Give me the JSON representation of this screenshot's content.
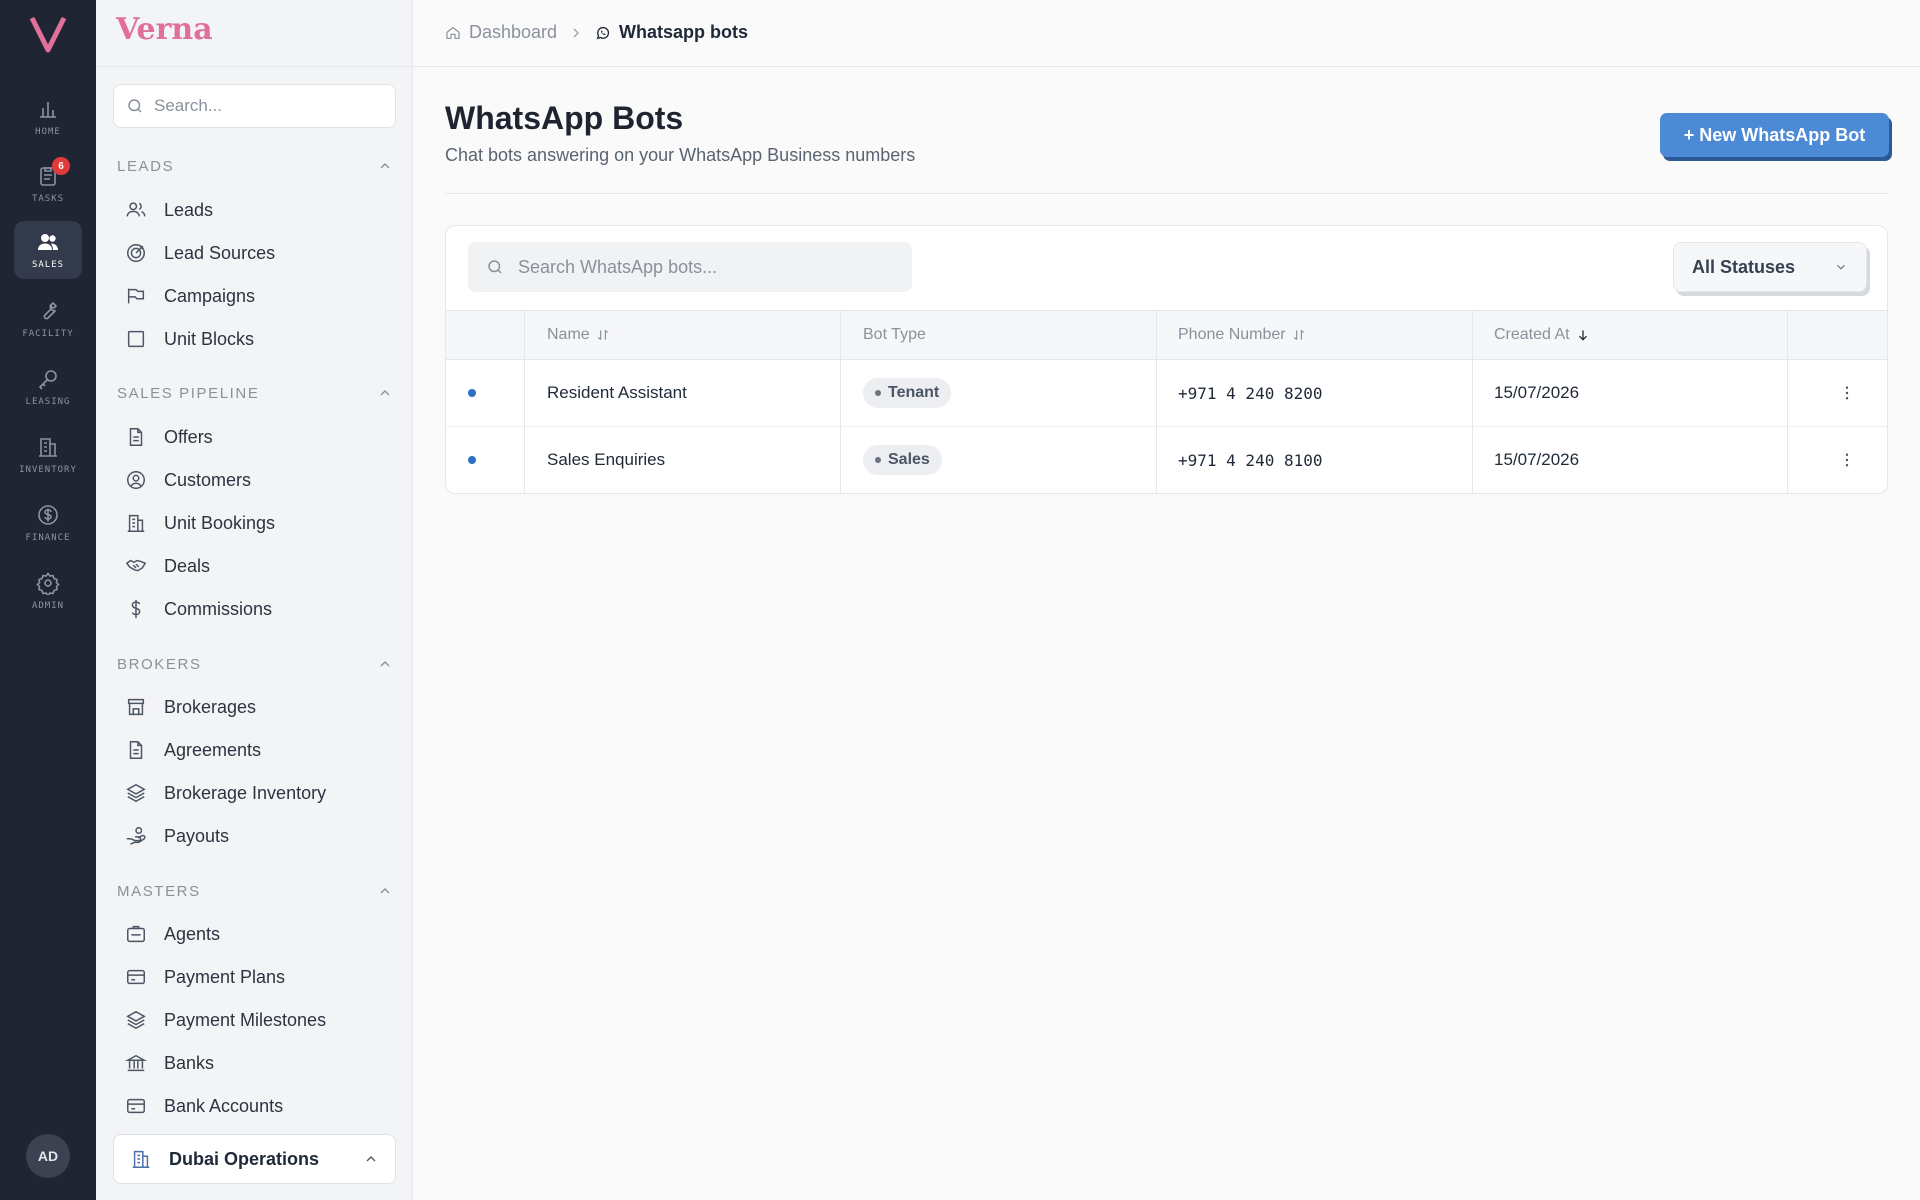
{
  "rail": {
    "logo": "V",
    "items": [
      {
        "label": "HOME",
        "icon": "bar-chart-icon"
      },
      {
        "label": "TASKS",
        "icon": "clipboard-icon",
        "badge": "6"
      },
      {
        "label": "SALES",
        "icon": "users-icon",
        "active": true
      },
      {
        "label": "FACILITY",
        "icon": "wrench-icon"
      },
      {
        "label": "LEASING",
        "icon": "key-icon"
      },
      {
        "label": "INVENTORY",
        "icon": "building-icon"
      },
      {
        "label": "FINANCE",
        "icon": "dollar-circle-icon"
      },
      {
        "label": "ADMIN",
        "icon": "gear-icon"
      }
    ],
    "avatar": "AD"
  },
  "sidebar": {
    "brand": "Verna",
    "search_placeholder": "Search...",
    "sections": [
      {
        "title": "LEADS",
        "items": [
          "Leads",
          "Lead Sources",
          "Campaigns",
          "Unit Blocks"
        ]
      },
      {
        "title": "SALES PIPELINE",
        "items": [
          "Offers",
          "Customers",
          "Unit Bookings",
          "Deals",
          "Commissions"
        ]
      },
      {
        "title": "BROKERS",
        "items": [
          "Brokerages",
          "Agreements",
          "Brokerage Inventory",
          "Payouts"
        ]
      },
      {
        "title": "MASTERS",
        "items": [
          "Agents",
          "Payment Plans",
          "Payment Milestones",
          "Banks",
          "Bank Accounts"
        ]
      }
    ],
    "org": "Dubai Operations"
  },
  "breadcrumb": {
    "home": "Dashboard",
    "current": "Whatsapp bots"
  },
  "page": {
    "title": "WhatsApp Bots",
    "subtitle": "Chat bots answering on your WhatsApp Business numbers",
    "new_button": "+ New WhatsApp Bot"
  },
  "table": {
    "search_placeholder": "Search WhatsApp bots...",
    "status_filter": "All Statuses",
    "columns": {
      "name": "Name",
      "bot_type": "Bot Type",
      "phone": "Phone Number",
      "created": "Created At"
    },
    "rows": [
      {
        "name": "Resident Assistant",
        "bot_type": "Tenant",
        "phone": "+971 4 240 8200",
        "created": "15/07/2026"
      },
      {
        "name": "Sales Enquiries",
        "bot_type": "Sales",
        "phone": "+971 4 240 8100",
        "created": "15/07/2026"
      }
    ]
  },
  "colors": {
    "accent": "#4d8ad6",
    "brand": "#e0709a",
    "rail": "#1f2533",
    "status_dot": "#2f6fc3",
    "badge": "#e03a3a"
  }
}
